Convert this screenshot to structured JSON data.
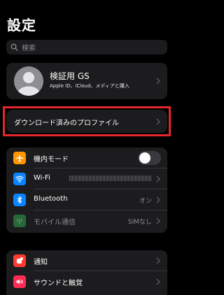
{
  "header": {
    "title": "設定"
  },
  "search": {
    "placeholder": "検索"
  },
  "profile": {
    "name": "検証用 GS",
    "subtitle": "Apple ID、iCloud、メディアと購入"
  },
  "downloaded_profile": {
    "label": "ダウンロード済みのプロファイル"
  },
  "settings": {
    "airplane": {
      "label": "機内モード",
      "icon": "airplane-icon",
      "color": "#ff9500",
      "enabled": false
    },
    "wifi": {
      "label": "Wi-Fi",
      "icon": "wifi-icon",
      "color": "#0a84ff"
    },
    "bluetooth": {
      "label": "Bluetooth",
      "value": "オン",
      "icon": "bluetooth-icon",
      "color": "#0a84ff"
    },
    "cellular": {
      "label": "モバイル通信",
      "value": "SIMなし",
      "icon": "antenna-icon",
      "color": "#34c759"
    }
  },
  "alerts": {
    "notifications": {
      "label": "通知",
      "icon": "bell-icon",
      "color": "#ff3b30"
    },
    "sounds": {
      "label": "サウンドと触覚",
      "icon": "speaker-icon",
      "color": "#ff2d55"
    }
  },
  "colors": {
    "highlight": "#e5262a",
    "background": "#000000",
    "cell": "#1c1c1e"
  }
}
